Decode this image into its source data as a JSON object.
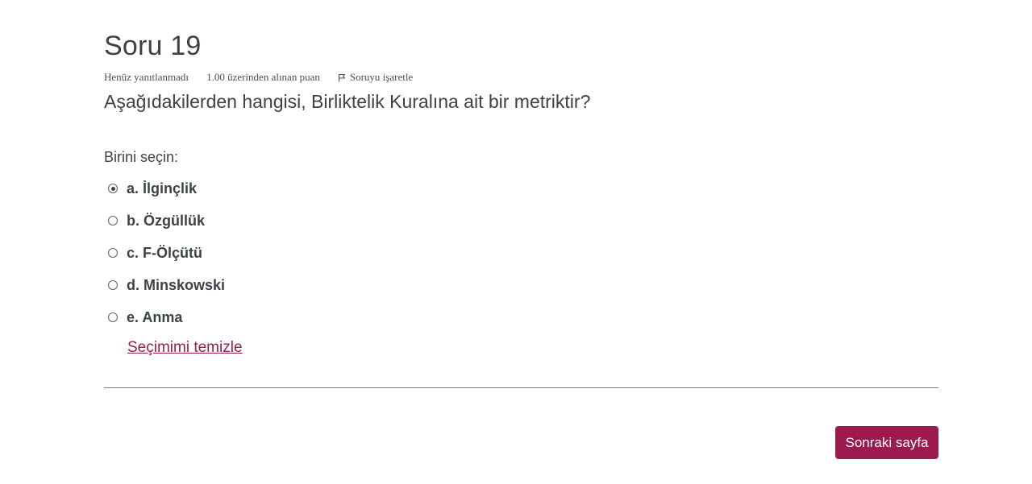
{
  "question": {
    "title": "Soru 19",
    "status": "Henüz yanıtlanmadı",
    "grade": "1.00 üzerinden alınan puan",
    "flag_label": "Soruyu işaretle",
    "text": "Aşağıdakilerden hangisi, Birliktelik Kuralına ait bir metriktir?",
    "prompt": "Birini seçin:",
    "answers": [
      {
        "label": "a. İlginçlik",
        "selected": true
      },
      {
        "label": "b. Özgüllük",
        "selected": false
      },
      {
        "label": "c. F-Ölçütü",
        "selected": false
      },
      {
        "label": "d. Minskowski",
        "selected": false
      },
      {
        "label": "e. Anma",
        "selected": false
      }
    ],
    "clear_label": "Seçimimi temizle"
  },
  "navigation": {
    "next_label": "Sonraki sayfa"
  },
  "colors": {
    "accent": "#9c1a4d",
    "divider": "#c7577e",
    "text": "#3d4248"
  },
  "icons": {
    "flag": "flag-icon",
    "radio_selected": "radio-selected-icon",
    "radio_unselected": "radio-unselected-icon"
  }
}
